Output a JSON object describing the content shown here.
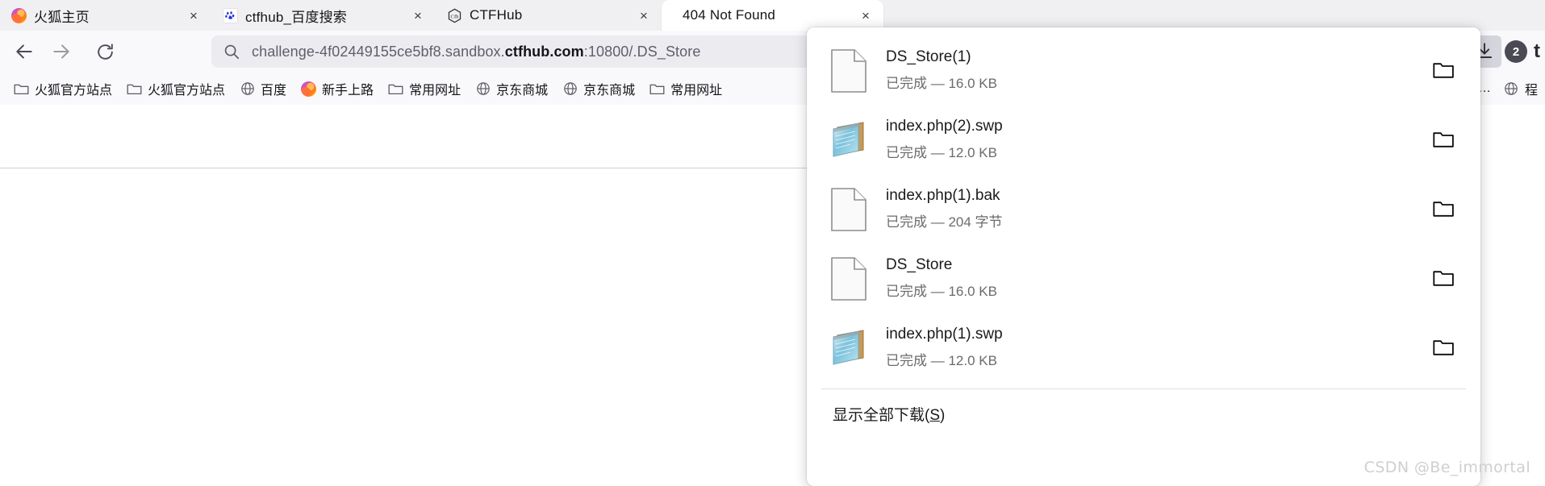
{
  "browser": {
    "tabs": [
      {
        "title": "火狐主页",
        "favicon": "firefox-logo-icon",
        "close": "×",
        "active": false
      },
      {
        "title": "ctfhub_百度搜索",
        "favicon": "baidu-paw-icon",
        "close": "×",
        "active": false
      },
      {
        "title": "CTFHub",
        "favicon": "ctfhub-hexagon-icon",
        "close": "×",
        "active": false
      },
      {
        "title": "404 Not Found",
        "favicon": "none",
        "close": "×",
        "active": true
      }
    ],
    "nav": {
      "back_icon": "arrow-left-icon",
      "forward_icon": "arrow-right-icon",
      "reload_icon": "reload-icon"
    },
    "urlbar": {
      "search_icon": "search-icon",
      "prefix": "challenge-4f02449155ce5bf8.sandbox.",
      "domain": "ctfhub.com",
      "suffix": ":10800/.DS_Store"
    },
    "toolbar_right": {
      "download_icon": "download-arrow-icon",
      "download_badge": "2",
      "profile_label": "t"
    },
    "bookmarks": [
      {
        "label": "火狐官方站点",
        "icon": "folder-icon"
      },
      {
        "label": "火狐官方站点",
        "icon": "folder-icon"
      },
      {
        "label": "百度",
        "icon": "globe-icon"
      },
      {
        "label": "新手上路",
        "icon": "firefox-logo-icon"
      },
      {
        "label": "常用网址",
        "icon": "folder-icon"
      },
      {
        "label": "京东商城",
        "icon": "globe-icon"
      },
      {
        "label": "京东商城",
        "icon": "globe-icon"
      },
      {
        "label": "常用网址",
        "icon": "folder-icon"
      },
      {
        "label": "程",
        "icon": "globe-icon"
      }
    ],
    "bookmarks_overflow": "…"
  },
  "downloads_panel": {
    "items": [
      {
        "name": "DS_Store(1)",
        "status": "已完成 — 16.0 KB",
        "icon": "generic-file-icon",
        "folder_icon": "folder-open-icon"
      },
      {
        "name": "index.php(2).swp",
        "status": "已完成 — 12.0 KB",
        "icon": "notepad-file-icon",
        "folder_icon": "folder-open-icon"
      },
      {
        "name": "index.php(1).bak",
        "status": "已完成 — 204 字节",
        "icon": "generic-file-icon",
        "folder_icon": "folder-open-icon"
      },
      {
        "name": "DS_Store",
        "status": "已完成 — 16.0 KB",
        "icon": "generic-file-icon",
        "folder_icon": "folder-open-icon"
      },
      {
        "name": "index.php(1).swp",
        "status": "已完成 — 12.0 KB",
        "icon": "notepad-file-icon",
        "folder_icon": "folder-open-icon"
      }
    ],
    "footer": {
      "label_prefix": "显示全部下载(",
      "accesskey": "S",
      "label_suffix": ")"
    }
  },
  "watermark": "CSDN @Be_immortal",
  "colors": {
    "tabstrip_bg": "#f0f0f2",
    "toolbar_bg": "#f9f9fb",
    "urlbar_bg": "#ececf0",
    "accent_text": "#15141a",
    "status_text": "#6b6b6b",
    "badge_bg": "#4a4a55"
  }
}
